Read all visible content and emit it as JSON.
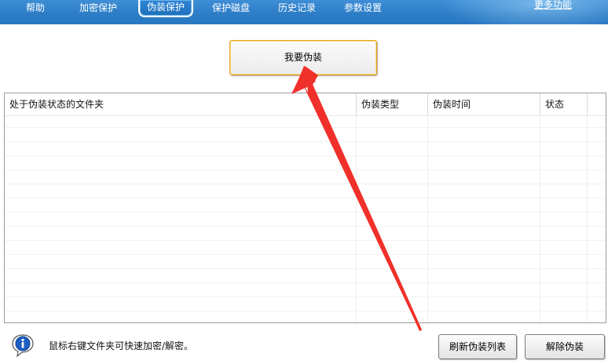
{
  "nav": {
    "tabs": [
      {
        "label": "帮助"
      },
      {
        "label": "加密保护"
      },
      {
        "label": "伪装保护",
        "active": true
      },
      {
        "label": "保护磁盘"
      },
      {
        "label": "历史记录"
      },
      {
        "label": "参数设置"
      }
    ],
    "more_link": "更多功能"
  },
  "main": {
    "disguise_button": "我要伪装",
    "table": {
      "columns": [
        "处于伪装状态的文件夹",
        "伪装类型",
        "伪装时间",
        "状态"
      ],
      "rows": []
    }
  },
  "footer": {
    "hint": "鼠标右键文件夹可快速加密/解密。",
    "refresh_button": "刷新伪装列表",
    "remove_button": "解除伪装"
  },
  "colors": {
    "topbar": "#2c7cc6",
    "button_border_highlight": "#e3a21a",
    "annotation_arrow": "#f0302a"
  },
  "icons": {
    "info": "info-icon",
    "annotation": "red-arrow-annotation"
  }
}
